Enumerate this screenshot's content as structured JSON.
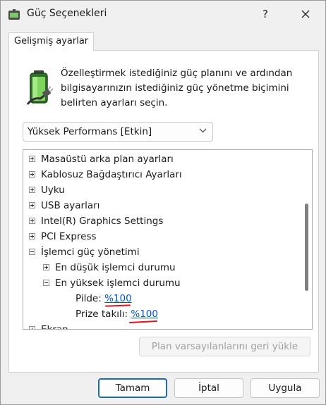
{
  "window": {
    "title": "Güç Seçenekleri",
    "help_label": "?"
  },
  "tab": {
    "label": "Gelişmiş ayarlar"
  },
  "description": "Özelleştirmek istediğiniz güç planını ve ardından bilgisayarınızın istediğiniz güç yönetme biçimini belirten ayarları seçin.",
  "plan_select": {
    "value": "Yüksek Performans [Etkin]"
  },
  "tree": {
    "items": [
      {
        "label": "Masaüstü arka plan ayarları",
        "state": "collapsed"
      },
      {
        "label": "Kablosuz Bağdaştırıcı Ayarları",
        "state": "collapsed"
      },
      {
        "label": "Uyku",
        "state": "collapsed"
      },
      {
        "label": "USB ayarları",
        "state": "collapsed"
      },
      {
        "label": "Intel(R) Graphics Settings",
        "state": "collapsed"
      },
      {
        "label": "PCI Express",
        "state": "collapsed"
      },
      {
        "label": "İşlemci güç yönetimi",
        "state": "expanded"
      },
      {
        "label": "En düşük işlemci durumu",
        "state": "collapsed"
      },
      {
        "label": "En yüksek işlemci durumu",
        "state": "expanded"
      },
      {
        "label": "Pilde:",
        "value": "%100"
      },
      {
        "label": "Prize takılı:",
        "value": "%100"
      },
      {
        "label": "Ekran",
        "state": "collapsed"
      }
    ]
  },
  "restore_button": "Plan varsayılanlarını geri yükle",
  "buttons": {
    "ok": "Tamam",
    "cancel": "İptal",
    "apply": "Uygula"
  },
  "colors": {
    "link": "#0056c7",
    "annotation": "#e0151f",
    "primary_border": "#1b67c2"
  },
  "icons": [
    "power-options-icon",
    "close-icon",
    "battery-plug-icon",
    "chevron-down-icon",
    "expand-icon",
    "collapse-icon"
  ]
}
